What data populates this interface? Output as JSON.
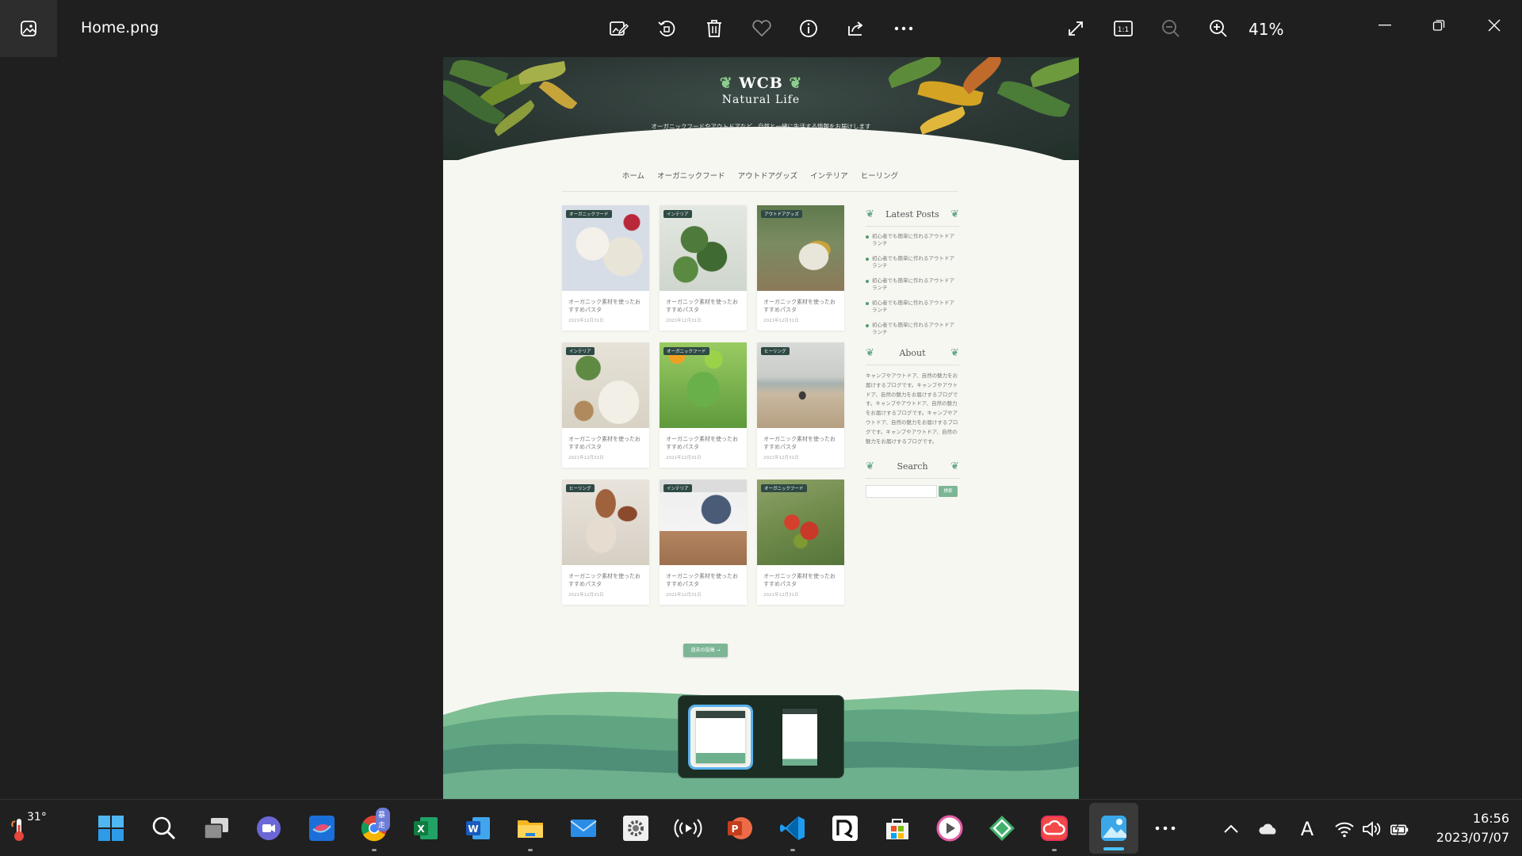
{
  "app": {
    "filename": "Home.png",
    "zoom_label": "41%",
    "toolbar_icons": [
      "edit-image-icon",
      "rotate-icon",
      "delete-icon",
      "favorite-icon",
      "info-icon",
      "share-icon",
      "more-icon"
    ],
    "view_icons": [
      "fullscreen-icon",
      "actual-size-icon",
      "zoom-out-icon",
      "zoom-in-icon"
    ]
  },
  "site": {
    "logo_main": "WCB",
    "logo_sub": "Natural Life",
    "tagline": "オーガニックフードやアウトドアなど、自然と一緒に生活する情報をお届けします",
    "nav": [
      "ホーム",
      "オーガニックフード",
      "アウトドアグッズ",
      "インテリア",
      "ヒーリング"
    ],
    "posts": [
      {
        "category": "オーガニックフード",
        "title": "オーガニック素材を使ったおすすめパスタ",
        "date": "2021年12月31日"
      },
      {
        "category": "インテリア",
        "title": "オーガニック素材を使ったおすすめパスタ",
        "date": "2021年12月31日"
      },
      {
        "category": "アウトドアグッズ",
        "title": "オーガニック素材を使ったおすすめパスタ",
        "date": "2021年12月31日"
      },
      {
        "category": "インテリア",
        "title": "オーガニック素材を使ったおすすめパスタ",
        "date": "2021年12月31日"
      },
      {
        "category": "オーガニックフード",
        "title": "オーガニック素材を使ったおすすめパスタ",
        "date": "2021年12月31日"
      },
      {
        "category": "ヒーリング",
        "title": "オーガニック素材を使ったおすすめパスタ",
        "date": "2021年12月31日"
      },
      {
        "category": "ヒーリング",
        "title": "オーガニック素材を使ったおすすめパスタ",
        "date": "2021年12月31日"
      },
      {
        "category": "インテリア",
        "title": "オーガニック素材を使ったおすすめパスタ",
        "date": "2021年12月31日"
      },
      {
        "category": "オーガニックフード",
        "title": "オーガニック素材を使ったおすすめパスタ",
        "date": "2021年12月31日"
      }
    ],
    "more_button": "過去の投稿 →",
    "sidebar": {
      "latest_title": "Latest Posts",
      "latest_items": [
        "初心者でも簡単に作れるアウトドアランチ",
        "初心者でも簡単に作れるアウトドアランチ",
        "初心者でも簡単に作れるアウトドアランチ",
        "初心者でも簡単に作れるアウトドアランチ",
        "初心者でも簡単に作れるアウトドアランチ"
      ],
      "about_title": "About",
      "about_text": "キャンプやアウトドア、自然の魅力をお届けするブログです。キャンプやアウトドア、自然の魅力をお届けするブログです。キャンプやアウトドア、自然の魅力をお届けするブログです。キャンプやアウトドア、自然の魅力をお届けするブログです。キャンプやアウトドア、自然の魅力をお届けするブログです。",
      "search_title": "Search",
      "search_button": "検索"
    }
  },
  "filmstrip": {
    "count": 2,
    "active_index": 0
  },
  "taskbar": {
    "temperature": "31°",
    "chrome_badge": "暴走",
    "apps": [
      "start-icon",
      "search-icon",
      "task-view-icon",
      "teams-icon",
      "app-icon",
      "chrome-icon",
      "excel-icon",
      "word-icon",
      "file-explorer-icon",
      "mail-icon",
      "settings-icon",
      "podcast-icon",
      "powerpoint-icon",
      "vscode-icon",
      "app-icon",
      "microsoft-store-icon",
      "media-player-icon",
      "app-icon",
      "creative-cloud-icon",
      "photos-icon",
      "more-apps-icon"
    ],
    "tray_icons": [
      "chevron-up-icon",
      "onedrive-icon",
      "ime-icon",
      "wifi-icon",
      "volume-icon",
      "battery-icon"
    ],
    "ime_label": "A",
    "time": "16:56",
    "date": "2023/07/07"
  }
}
